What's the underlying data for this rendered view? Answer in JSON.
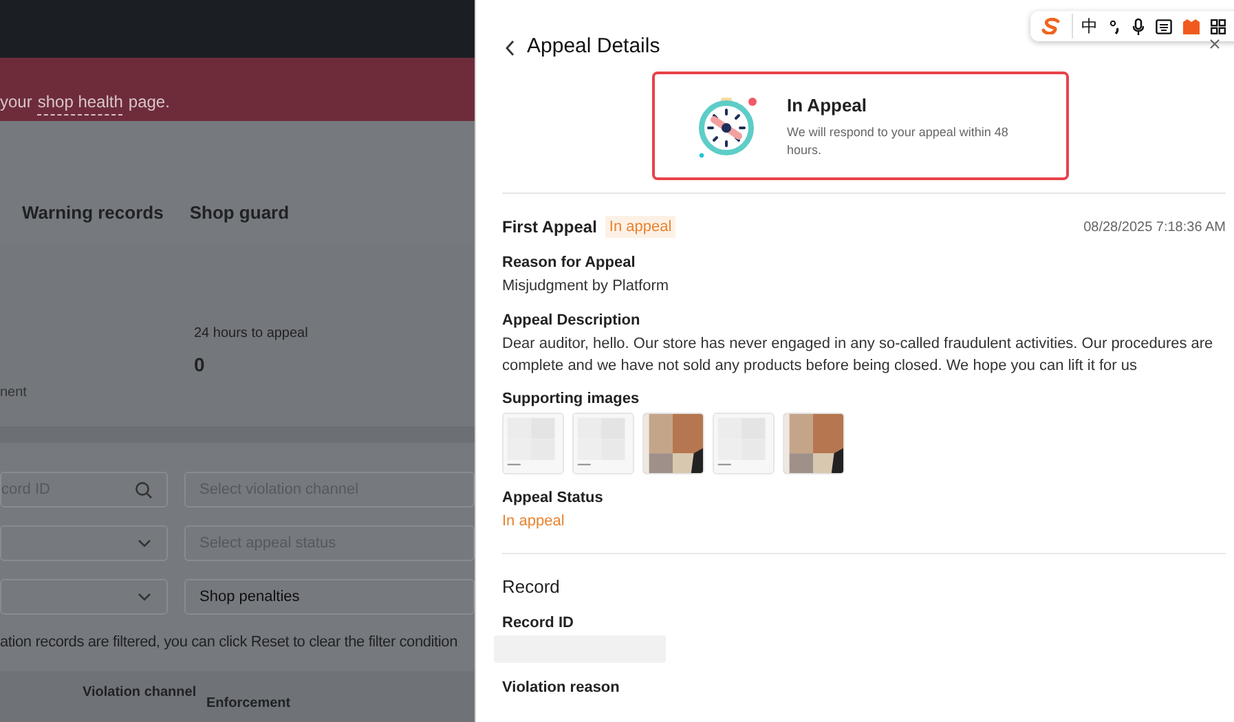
{
  "background_page": {
    "banner": {
      "prefix": "your",
      "link": "shop health",
      "suffix": "page."
    },
    "tabs": [
      {
        "label": "Warning records"
      },
      {
        "label": "Shop guard"
      }
    ],
    "stats": [
      {
        "label": "24 hours to appeal",
        "value": "0"
      }
    ],
    "stat_caption": "nent",
    "filters": [
      {
        "kind": "search",
        "placeholder": "cord ID"
      },
      {
        "kind": "select",
        "placeholder": "Select violation channel"
      },
      {
        "kind": "dropdown"
      },
      {
        "kind": "select",
        "placeholder": "Select appeal status"
      },
      {
        "kind": "dropdown"
      },
      {
        "kind": "select",
        "value": "Shop penalties"
      }
    ],
    "notice": "ation records are filtered, you can click Reset to clear the filter condition",
    "table": {
      "columns": [
        "Violation channel",
        "Enforcement"
      ]
    }
  },
  "ime_toolbar": {
    "language": "中"
  },
  "drawer": {
    "title": "Appeal Details",
    "status_card": {
      "title": "In Appeal",
      "message": "We will respond to your appeal within 48 hours."
    },
    "appeal": {
      "title": "First Appeal",
      "badge": "In appeal",
      "time": "08/28/2025 7:18:36 AM",
      "fields": [
        {
          "label": "Reason for Appeal",
          "value": "Misjudgment by Platform"
        },
        {
          "label": "Appeal Description",
          "value": "Dear auditor, hello. Our store has never engaged in any so-called fraudulent activities. Our procedures are complete and we have not sold any products before being closed. We hope you can lift it for us"
        }
      ],
      "images": {
        "label": "Supporting images"
      },
      "status": {
        "label": "Appeal Status",
        "value": "In appeal"
      }
    },
    "record": {
      "heading": "Record",
      "fields": [
        {
          "label": "Record ID",
          "redacted": true
        },
        {
          "label": "Violation reason"
        }
      ]
    }
  }
}
